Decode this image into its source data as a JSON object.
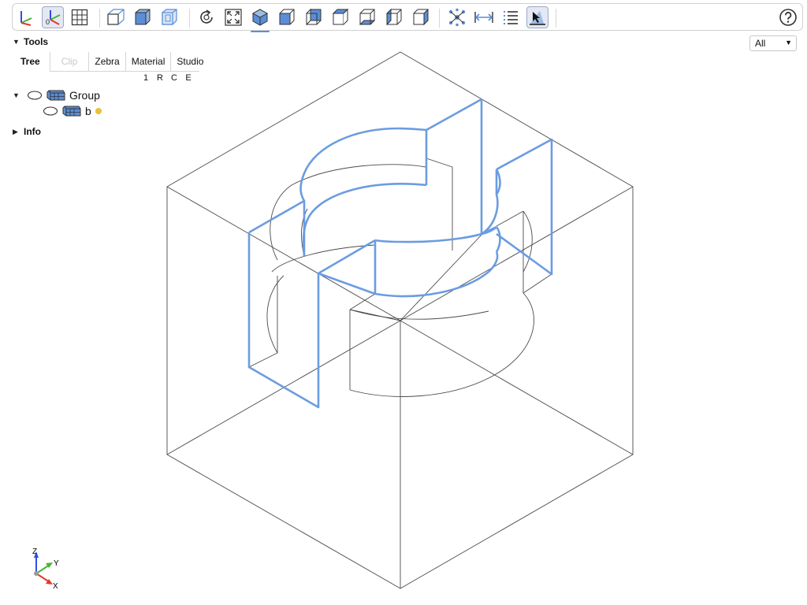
{
  "toolbar": {
    "buttons": [
      {
        "name": "axes-toggle-icon"
      },
      {
        "name": "axes-origin-toggle-icon",
        "active": true,
        "label": "0"
      },
      {
        "name": "grid-toggle-icon"
      },
      {
        "name": "perspective-view-icon"
      },
      {
        "name": "transparent-view-icon"
      },
      {
        "name": "black-edges-view-icon"
      },
      {
        "name": "reset-view-icon"
      },
      {
        "name": "zoom-to-fit-icon"
      },
      {
        "name": "iso-view-icon",
        "underline": true
      },
      {
        "name": "front-view-icon"
      },
      {
        "name": "rear-view-icon"
      },
      {
        "name": "top-view-icon"
      },
      {
        "name": "bottom-view-icon"
      },
      {
        "name": "left-view-icon"
      },
      {
        "name": "right-view-icon"
      },
      {
        "name": "explode-icon"
      },
      {
        "name": "distance-measure-icon"
      },
      {
        "name": "properties-list-icon"
      },
      {
        "name": "select-mode-icon",
        "active": true
      },
      {
        "name": "help-icon"
      }
    ]
  },
  "panel": {
    "tools_label": "Tools",
    "tabs": [
      "Tree",
      "Clip",
      "Zebra",
      "Material",
      "Studio"
    ],
    "columns": [
      "1",
      "R",
      "C",
      "E"
    ],
    "tree": {
      "group_label": "Group",
      "child_label": "b"
    },
    "info_label": "Info"
  },
  "dropdown": {
    "value": "All"
  },
  "axes": {
    "x": "X",
    "y": "Y",
    "z": "Z"
  },
  "colors": {
    "accent": "#5b8ed6",
    "selection_edges": "#6b9ce0",
    "wire": "#4a4a4a",
    "marker": "#e8c03a",
    "axis_x": "#e03a2e",
    "axis_y": "#47b534",
    "axis_z": "#2d4fe0"
  }
}
